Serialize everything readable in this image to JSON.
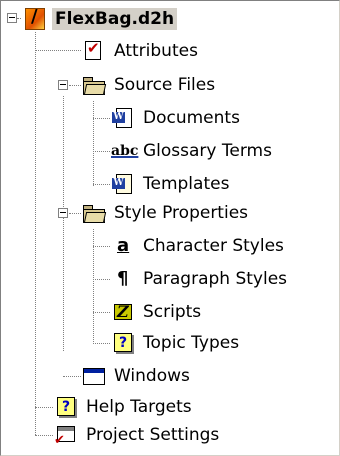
{
  "tree": {
    "root": {
      "label": "FlexBag.d2h",
      "icon": "project-icon"
    },
    "attributes": {
      "label": "Attributes",
      "icon": "checklist-icon"
    },
    "source_files": {
      "label": "Source Files",
      "icon": "folder-icon",
      "children": [
        {
          "label": "Documents",
          "icon": "word-document-icon"
        },
        {
          "label": "Glossary Terms",
          "icon": "abc-glossary-icon"
        },
        {
          "label": "Templates",
          "icon": "word-template-icon"
        }
      ]
    },
    "style_properties": {
      "label": "Style Properties",
      "icon": "folder-icon",
      "children": [
        {
          "label": "Character Styles",
          "icon": "character-style-icon",
          "glyph": "a"
        },
        {
          "label": "Paragraph Styles",
          "icon": "paragraph-style-icon",
          "glyph": "¶"
        },
        {
          "label": "Scripts",
          "icon": "script-icon"
        },
        {
          "label": "Topic Types",
          "icon": "help-topic-icon",
          "glyph": "?"
        }
      ]
    },
    "windows": {
      "label": "Windows",
      "icon": "window-icon"
    },
    "help_targets": {
      "label": "Help Targets",
      "icon": "help-topic-icon",
      "glyph": "?"
    },
    "project_settings": {
      "label": "Project Settings",
      "icon": "project-settings-icon"
    }
  },
  "badges": {
    "word": "W",
    "glossary": "abc"
  },
  "colors": {
    "selection": "#d4d0c8",
    "tree_line": "#808080",
    "accent_blue": "#2040a0"
  }
}
